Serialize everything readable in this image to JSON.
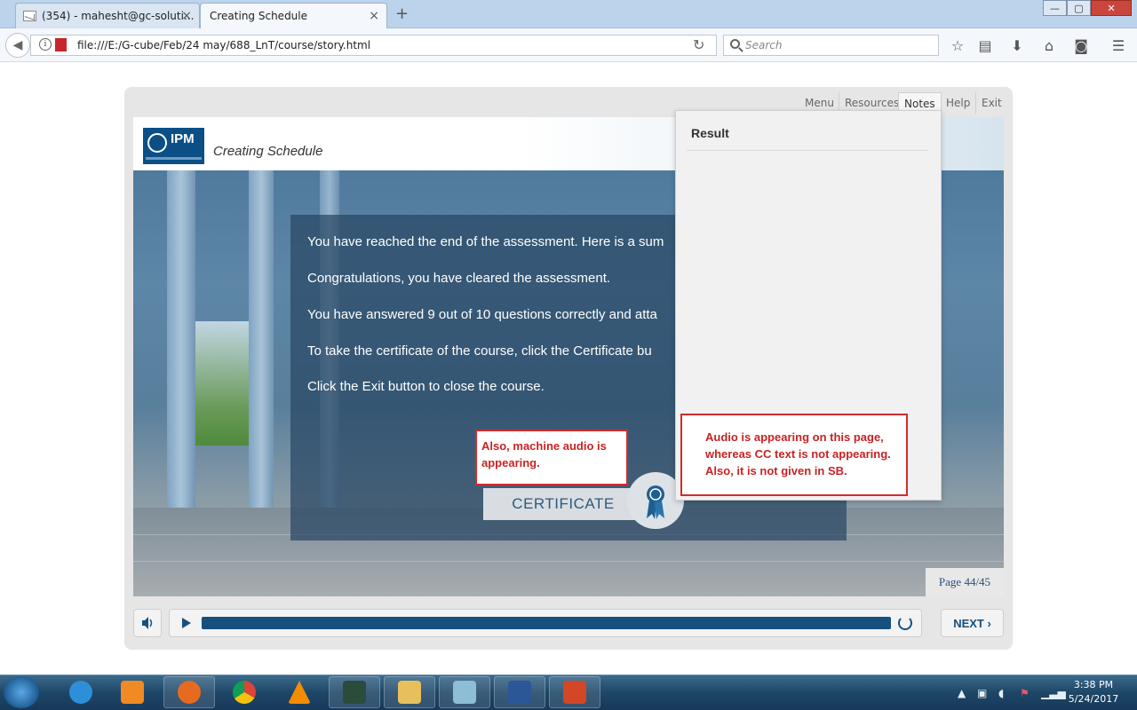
{
  "browser": {
    "tabs": [
      {
        "label": "(354) - mahesht@gc-soluti...",
        "active": false
      },
      {
        "label": "Creating Schedule",
        "active": true
      }
    ],
    "new_tab_symbol": "+",
    "url": "file:///E:/G-cube/Feb/24 may/688_LnT/course/story.html",
    "search_placeholder": "Search",
    "window_controls": {
      "minimize": "—",
      "maximize": "▢",
      "close": "✕"
    }
  },
  "course": {
    "logo_text": "IPM",
    "title": "Creating Schedule",
    "nav": [
      "Menu",
      "Resources",
      "Notes",
      "Help",
      "Exit"
    ],
    "active_nav": "Notes",
    "body_lines": [
      "You have reached the end of the assessment. Here is a sum",
      "Congratulations, you have cleared the assessment.",
      "You have answered 9 out of 10 questions correctly and atta",
      "To take the certificate of the course, click the Certificate bu",
      "Click the Exit button to close the course."
    ],
    "certificate_button": "CERTIFICATE",
    "page_indicator": "Page 44/45",
    "notes": {
      "heading": "Result"
    },
    "controls": {
      "next_label": "NEXT ›",
      "progress": 1.0
    }
  },
  "annotations": [
    {
      "text": "Also, machine audio is appearing."
    },
    {
      "text": "Audio is appearing on this page, whereas CC text is not appearing. Also, it is not given in SB."
    }
  ],
  "taskbar": {
    "time": "3:38 PM",
    "date": "5/24/2017",
    "apps": [
      "internet-explorer",
      "media-player",
      "firefox",
      "chrome",
      "vlc",
      "slides",
      "file-explorer",
      "notepad",
      "word",
      "powerpoint"
    ]
  },
  "colors": {
    "accent": "#16507f",
    "annotation_red": "#d42b2b",
    "brand_blue": "#0b4f86"
  }
}
